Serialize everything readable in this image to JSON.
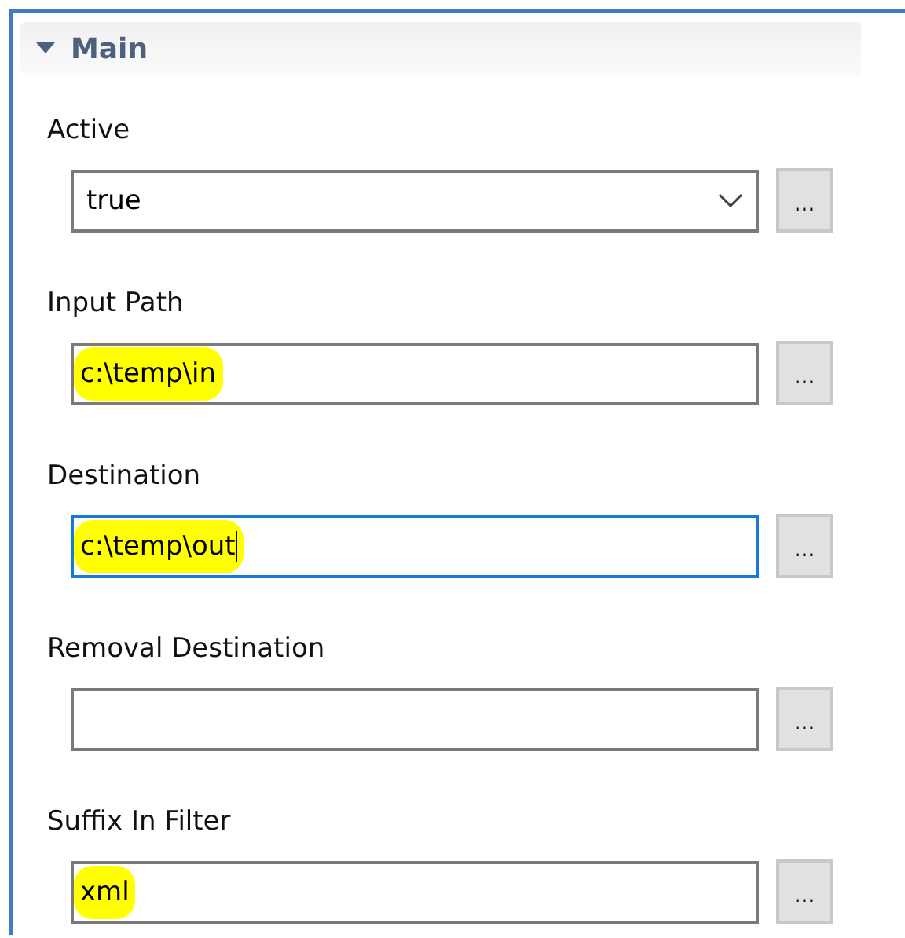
{
  "section": {
    "title": "Main",
    "expanded": true
  },
  "fields": [
    {
      "label": "Active",
      "kind": "dropdown",
      "value": "true",
      "highlighted": false,
      "focused": false,
      "button": "..."
    },
    {
      "label": "Input Path",
      "kind": "text",
      "value": "c:\\temp\\in",
      "highlighted": true,
      "focused": false,
      "button": "..."
    },
    {
      "label": "Destination",
      "kind": "text",
      "value": "c:\\temp\\out",
      "highlighted": true,
      "focused": true,
      "button": "..."
    },
    {
      "label": "Removal Destination",
      "kind": "text",
      "focused": false,
      "button": "..."
    },
    {
      "label": "Suffix In Filter",
      "kind": "text",
      "value": "xml",
      "highlighted": true,
      "focused": false,
      "button": "..."
    }
  ]
}
